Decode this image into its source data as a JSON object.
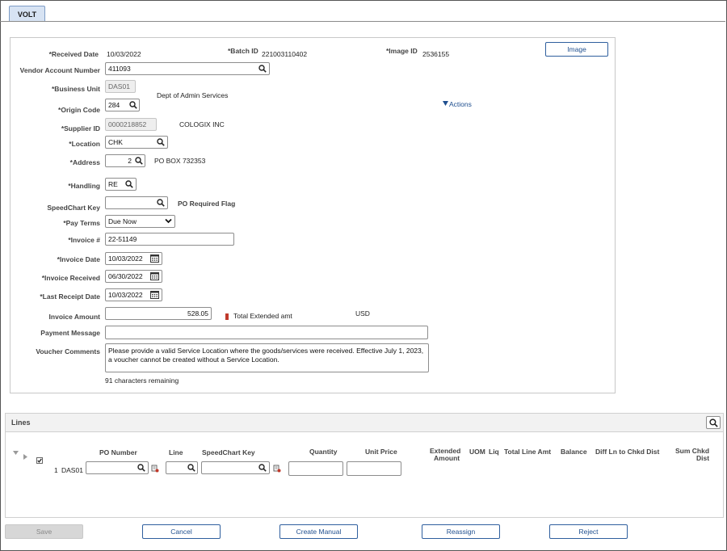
{
  "tab": {
    "label": "VOLT"
  },
  "header": {
    "received_date_label": "*Received Date",
    "received_date": "10/03/2022",
    "batch_id_label": "*Batch ID",
    "batch_id": "221003110402",
    "image_id_label": "*Image ID",
    "image_id": "2536155",
    "image_button": "Image"
  },
  "form": {
    "vendor_account_label": "Vendor Account Number",
    "vendor_account": "411093",
    "business_unit_label": "*Business Unit",
    "business_unit": "DAS01",
    "business_unit_desc": "Dept of Admin Services",
    "origin_code_label": "*Origin Code",
    "origin_code": "284",
    "actions_link": "Actions",
    "supplier_id_label": "*Supplier ID",
    "supplier_id": "0000218852",
    "supplier_name": "COLOGIX INC",
    "location_label": "*Location",
    "location": "CHK",
    "address_label": "*Address",
    "address": "2",
    "address_desc": "PO BOX 732353",
    "handling_label": "*Handling",
    "handling": "RE",
    "speedchart_label": "SpeedChart Key",
    "speedchart": "",
    "po_required_flag": "PO Required Flag",
    "pay_terms_label": "*Pay Terms",
    "pay_terms": "Due Now",
    "invoice_num_label": "*Invoice #",
    "invoice_num": "22-51149",
    "invoice_date_label": "*Invoice Date",
    "invoice_date": "10/03/2022",
    "invoice_received_label": "*Invoice Received",
    "invoice_received": "06/30/2022",
    "last_receipt_label": "*Last Receipt Date",
    "last_receipt": "10/03/2022",
    "invoice_amount_label": "Invoice Amount",
    "invoice_amount": "528.05",
    "total_extended_label": "Total Extended amt",
    "currency": "USD",
    "payment_message_label": "Payment Message",
    "payment_message": "",
    "voucher_comments_label": "Voucher Comments",
    "voucher_comments": "Please provide a valid Service Location where the goods/services were received. Effective July 1, 2023, a voucher cannot be created without a Service Location.",
    "chars_remaining": "91 characters remaining"
  },
  "lines": {
    "title": "Lines",
    "columns": {
      "po_number": "PO Number",
      "line": "Line",
      "speedchart_key": "SpeedChart Key",
      "quantity": "Quantity",
      "unit_price": "Unit Price",
      "extended_amount_1": "Extended",
      "extended_amount_2": "Amount",
      "uom": "UOM",
      "liq": "Liq",
      "total_line_amt": "Total Line Amt",
      "balance": "Balance",
      "diff_ln": "Diff Ln to Chkd Dist",
      "sum_chkd_1": "Sum Chkd",
      "sum_chkd_2": "Dist"
    },
    "row": {
      "line_no": "1",
      "business_unit": "DAS01"
    }
  },
  "footer": {
    "save": "Save",
    "cancel": "Cancel",
    "create_manual": "Create Manual",
    "reassign": "Reassign",
    "reject": "Reject"
  },
  "colors": {
    "accent": "#2f5f9e",
    "tab_bg": "#d7e3f3",
    "flag_red": "#c0392b"
  }
}
